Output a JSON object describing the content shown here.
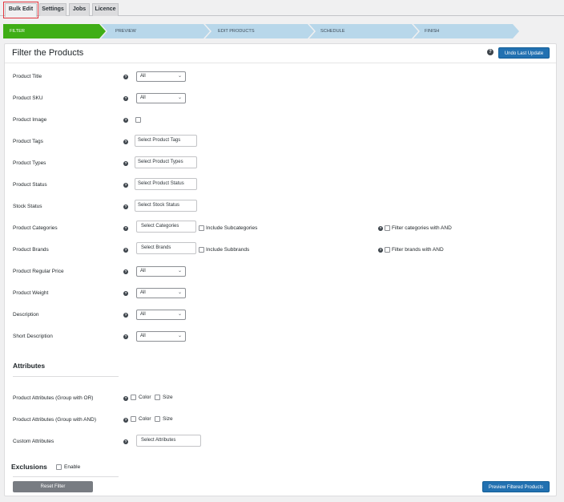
{
  "tabs": [
    "Bulk Edit",
    "Settings",
    "Jobs",
    "Licence"
  ],
  "steps": [
    "FILTER",
    "PREVIEW",
    "EDIT PRODUCTS",
    "SCHEDULE",
    "FINISH"
  ],
  "panel": {
    "title": "Filter the Products",
    "help_glyph": "?",
    "undo_label": "Undo Last Update"
  },
  "fields": {
    "product_title": {
      "label": "Product Title",
      "value": "All"
    },
    "product_sku": {
      "label": "Product SKU",
      "value": "All"
    },
    "product_image": {
      "label": "Product Image"
    },
    "product_tags": {
      "label": "Product Tags",
      "placeholder": "Select Product Tags"
    },
    "product_types": {
      "label": "Product Types",
      "placeholder": "Select Product Types"
    },
    "product_status": {
      "label": "Product Status",
      "placeholder": "Select Product Status"
    },
    "stock_status": {
      "label": "Stock Status",
      "placeholder": "Select Stock Status"
    },
    "product_categories": {
      "label": "Product Categories",
      "placeholder": "Select Categories",
      "include_label": "Include Subcategories",
      "and_label": "Filter categories with AND"
    },
    "product_brands": {
      "label": "Product Brands",
      "placeholder": "Select Brands",
      "include_label": "Include Subbrands",
      "and_label": "Filter brands with AND"
    },
    "regular_price": {
      "label": "Product Regular Price",
      "value": "All"
    },
    "weight": {
      "label": "Product Weight",
      "value": "All"
    },
    "description": {
      "label": "Description",
      "value": "All"
    },
    "short_description": {
      "label": "Short Description",
      "value": "All"
    }
  },
  "attributes": {
    "title": "Attributes",
    "group_or": {
      "label": "Product Attributes (Group with OR)",
      "options": [
        "Color",
        "Size"
      ]
    },
    "group_and": {
      "label": "Product Attributes (Group with AND)",
      "options": [
        "Color",
        "Size"
      ]
    },
    "custom": {
      "label": "Custom Attributes",
      "placeholder": "Select Attributes"
    }
  },
  "exclusions": {
    "title": "Exclusions",
    "enable_label": "Enable"
  },
  "footer": {
    "reset_label": "Reset Filter",
    "preview_label": "Preview Filtered Products"
  }
}
